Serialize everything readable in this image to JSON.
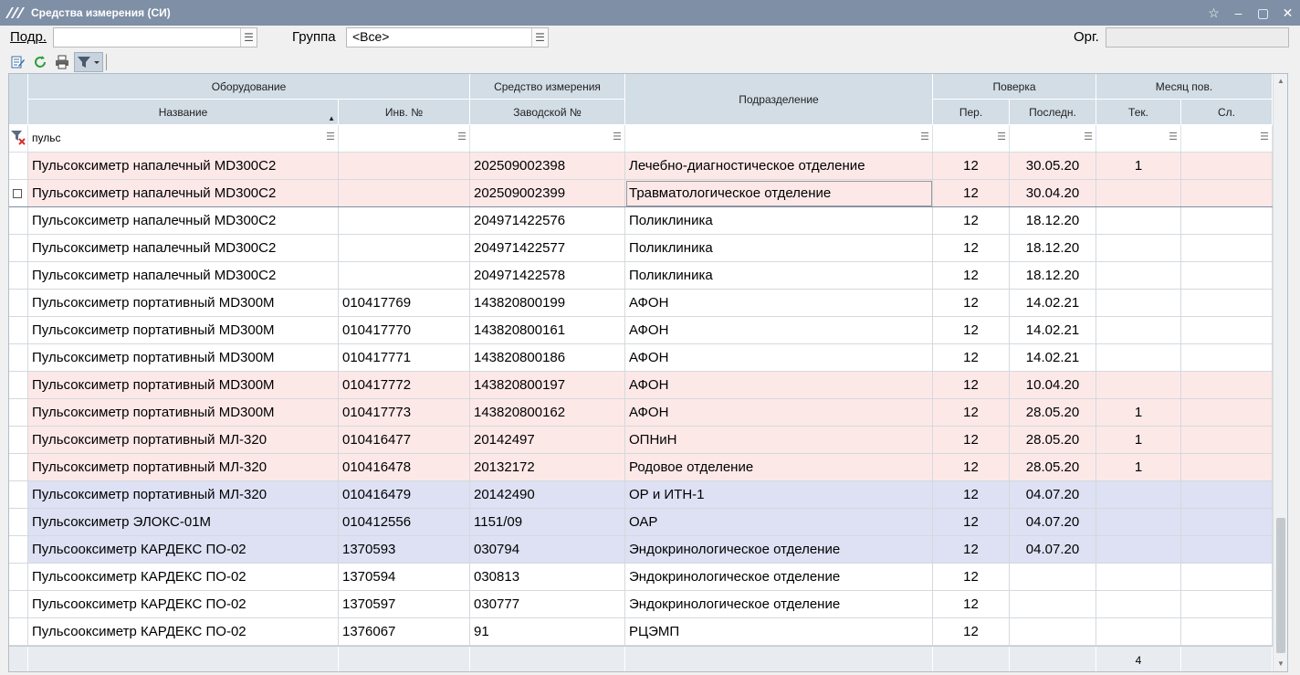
{
  "window": {
    "title": "Средства измерения (СИ)"
  },
  "filters": {
    "podr_label": "Подр.",
    "podr_value": "",
    "group_label": "Группа",
    "group_value": "<Все>",
    "org_label": "Орг.",
    "org_value": ""
  },
  "toolbar": {
    "edit_icon": "edit-icon",
    "refresh_icon": "refresh-icon",
    "print_icon": "print-icon",
    "filter_icon": "filter-icon"
  },
  "grid": {
    "group_headers": {
      "equipment": "Оборудование",
      "measure": "Средство измерения",
      "verification": "Поверка",
      "month": "Месяц пов."
    },
    "headers": {
      "name": "Название",
      "inv": "Инв. №",
      "serial": "Заводской №",
      "dept": "Подразделение",
      "per": "Пер.",
      "last": "Последн.",
      "cur": "Тек.",
      "next": "Сл."
    },
    "filter_name_value": "пульс",
    "rows": [
      {
        "name": "Пульсоксиметр напалечный MD300C2",
        "inv": "",
        "serial": "202509002398",
        "dept": "Лечебно-диагностическое отделение",
        "per": "12",
        "last": "30.05.20",
        "cur": "1",
        "next": "",
        "color": "pink"
      },
      {
        "name": "Пульсоксиметр напалечный MD300C2",
        "inv": "",
        "serial": "202509002399",
        "dept": "Травматологическое отделение",
        "per": "12",
        "last": "30.04.20",
        "cur": "",
        "next": "",
        "color": "pink"
      },
      {
        "name": "Пульсоксиметр напалечный MD300C2",
        "inv": "",
        "serial": "204971422576",
        "dept": "Поликлиника",
        "per": "12",
        "last": "18.12.20",
        "cur": "",
        "next": "",
        "color": "white"
      },
      {
        "name": "Пульсоксиметр напалечный MD300C2",
        "inv": "",
        "serial": "204971422577",
        "dept": "Поликлиника",
        "per": "12",
        "last": "18.12.20",
        "cur": "",
        "next": "",
        "color": "white"
      },
      {
        "name": "Пульсоксиметр напалечный MD300C2",
        "inv": "",
        "serial": "204971422578",
        "dept": "Поликлиника",
        "per": "12",
        "last": "18.12.20",
        "cur": "",
        "next": "",
        "color": "white"
      },
      {
        "name": "Пульсоксиметр портативный MD300M",
        "inv": "010417769",
        "serial": "143820800199",
        "dept": "АФОН",
        "per": "12",
        "last": "14.02.21",
        "cur": "",
        "next": "",
        "color": "white"
      },
      {
        "name": "Пульсоксиметр портативный MD300M",
        "inv": "010417770",
        "serial": "143820800161",
        "dept": "АФОН",
        "per": "12",
        "last": "14.02.21",
        "cur": "",
        "next": "",
        "color": "white"
      },
      {
        "name": "Пульсоксиметр портативный MD300M",
        "inv": "010417771",
        "serial": "143820800186",
        "dept": "АФОН",
        "per": "12",
        "last": "14.02.21",
        "cur": "",
        "next": "",
        "color": "white"
      },
      {
        "name": "Пульсоксиметр портативный MD300M",
        "inv": "010417772",
        "serial": "143820800197",
        "dept": "АФОН",
        "per": "12",
        "last": "10.04.20",
        "cur": "",
        "next": "",
        "color": "pink"
      },
      {
        "name": "Пульсоксиметр портативный MD300M",
        "inv": "010417773",
        "serial": "143820800162",
        "dept": "АФОН",
        "per": "12",
        "last": "28.05.20",
        "cur": "1",
        "next": "",
        "color": "pink"
      },
      {
        "name": "Пульсоксиметр портативный МЛ-320",
        "inv": "010416477",
        "serial": "20142497",
        "dept": "ОПНиН",
        "per": "12",
        "last": "28.05.20",
        "cur": "1",
        "next": "",
        "color": "pink"
      },
      {
        "name": "Пульсоксиметр портативный МЛ-320",
        "inv": "010416478",
        "serial": "20132172",
        "dept": "Родовое отделение",
        "per": "12",
        "last": "28.05.20",
        "cur": "1",
        "next": "",
        "color": "pink"
      },
      {
        "name": "Пульсоксиметр портативный МЛ-320",
        "inv": "010416479",
        "serial": "20142490",
        "dept": "ОР и ИТН-1",
        "per": "12",
        "last": "04.07.20",
        "cur": "",
        "next": "",
        "color": "blue"
      },
      {
        "name": "Пульсоксиметр ЭЛОКС-01М",
        "inv": "010412556",
        "serial": "1151/09",
        "dept": "ОАР",
        "per": "12",
        "last": "04.07.20",
        "cur": "",
        "next": "",
        "color": "blue"
      },
      {
        "name": "Пульсооксиметр КАРДЕКС ПО-02",
        "inv": "1370593",
        "serial": "030794",
        "dept": "Эндокринологическое отделение",
        "per": "12",
        "last": "04.07.20",
        "cur": "",
        "next": "",
        "color": "blue"
      },
      {
        "name": "Пульсооксиметр КАРДЕКС ПО-02",
        "inv": "1370594",
        "serial": "030813",
        "dept": "Эндокринологическое отделение",
        "per": "12",
        "last": "",
        "cur": "",
        "next": "",
        "color": "white"
      },
      {
        "name": "Пульсооксиметр КАРДЕКС ПО-02",
        "inv": "1370597",
        "serial": "030777",
        "dept": "Эндокринологическое отделение",
        "per": "12",
        "last": "",
        "cur": "",
        "next": "",
        "color": "white"
      },
      {
        "name": "Пульсооксиметр КАРДЕКС ПО-02",
        "inv": "1376067",
        "serial": "91",
        "dept": "РЦЭМП",
        "per": "12",
        "last": "",
        "cur": "",
        "next": "",
        "color": "white"
      }
    ],
    "footer_cur_total": "4"
  }
}
